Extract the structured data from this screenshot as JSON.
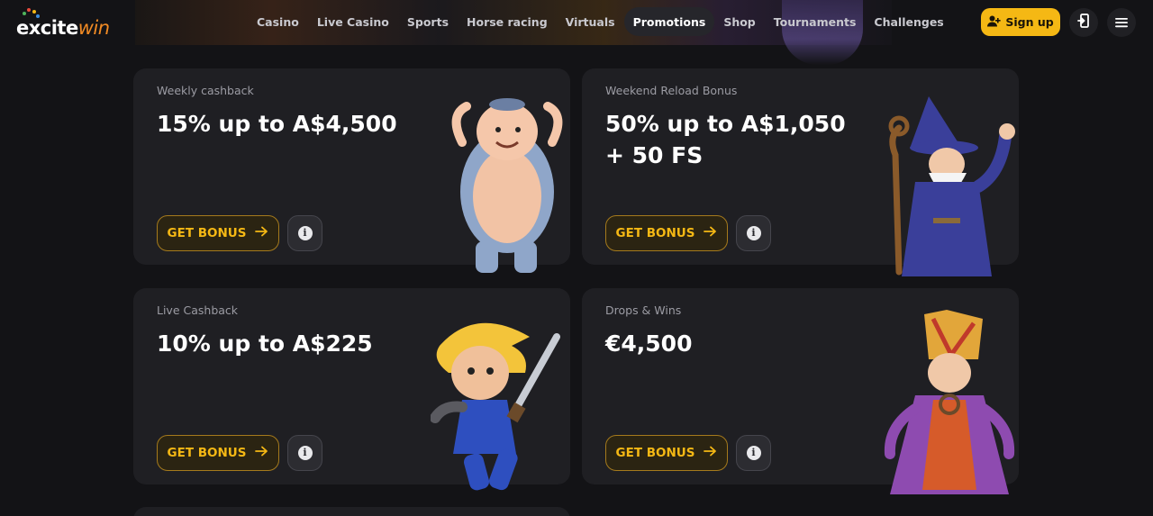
{
  "brand": {
    "logo_prefix": "excite",
    "logo_suffix": "win",
    "accent": "#f5b814",
    "logo_accent": "#f08a24"
  },
  "nav": {
    "items": [
      {
        "label": "Casino",
        "active": false
      },
      {
        "label": "Live Casino",
        "active": false
      },
      {
        "label": "Sports",
        "active": false
      },
      {
        "label": "Horse racing",
        "active": false
      },
      {
        "label": "Virtuals",
        "active": false
      },
      {
        "label": "Promotions",
        "active": true
      },
      {
        "label": "Shop",
        "active": false
      },
      {
        "label": "Tournaments",
        "active": false
      },
      {
        "label": "Challenges",
        "active": false
      }
    ]
  },
  "header": {
    "signup_label": "Sign up",
    "signup_icon": "user-plus-icon",
    "login_icon": "login-icon",
    "menu_icon": "hamburger-menu-icon"
  },
  "promotions": [
    {
      "label": "Weekly cashback",
      "title": "15% up to A$4,500",
      "button": "GET BONUS",
      "character": "pig-monk"
    },
    {
      "label": "Weekend Reload Bonus",
      "title": "50% up to A$1,050 + 50 FS",
      "button": "GET BONUS",
      "character": "wizard"
    },
    {
      "label": "Live Cashback",
      "title": "10% up to A$225",
      "button": "GET BONUS",
      "character": "blonde-swordsman"
    },
    {
      "label": "Drops & Wins",
      "title": "€4,500",
      "button": "GET BONUS",
      "character": "monk-king"
    }
  ]
}
